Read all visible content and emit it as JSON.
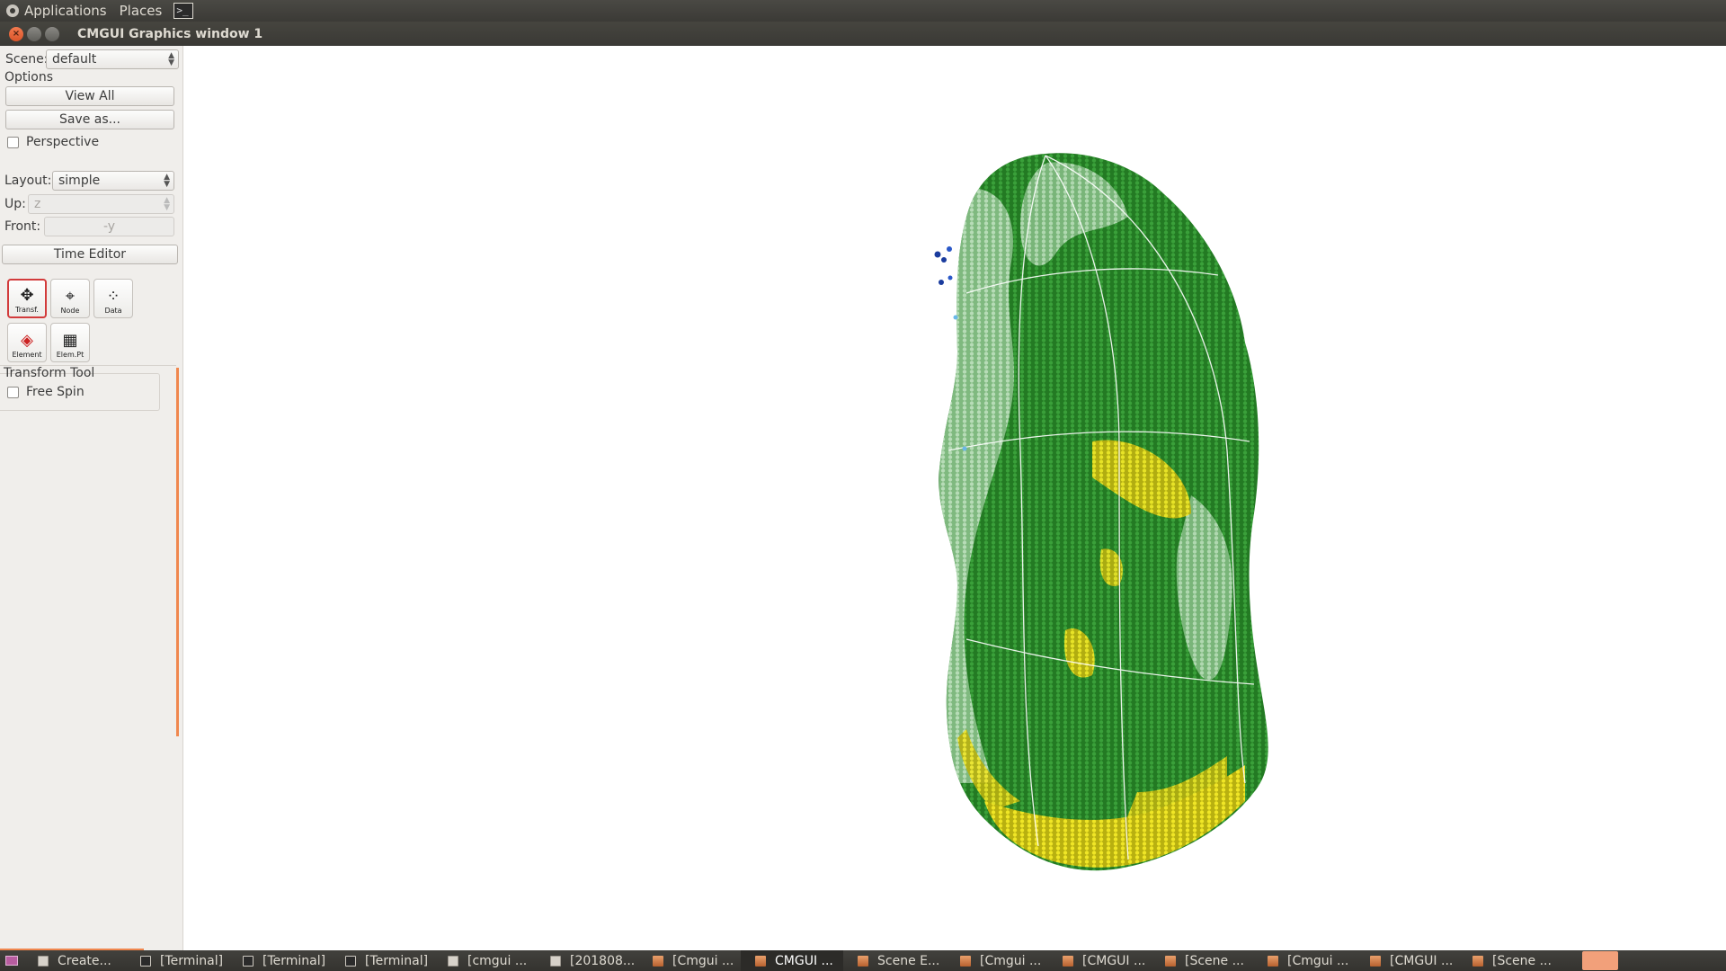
{
  "top_panel": {
    "applications_label": "Applications",
    "places_label": "Places"
  },
  "window": {
    "title": "CMGUI Graphics window 1"
  },
  "left_panel": {
    "scene_label": "Scene:",
    "scene_value": "default",
    "options_label": "Options",
    "view_all_label": "View All",
    "save_as_label": "Save as...",
    "perspective_label": "Perspective",
    "perspective_checked": false,
    "layout_label": "Layout:",
    "layout_value": "simple",
    "up_label": "Up:",
    "up_value": "z",
    "front_label": "Front:",
    "front_value": "-y",
    "time_editor_label": "Time Editor",
    "tools": [
      {
        "label": "Transf.",
        "icon": "transform-icon",
        "active": true
      },
      {
        "label": "Node",
        "icon": "node-tool-icon",
        "active": false
      },
      {
        "label": "Data",
        "icon": "data-tool-icon",
        "active": false
      },
      {
        "label": "Element",
        "icon": "element-tool-icon",
        "active": false
      },
      {
        "label": "Elem.Pt",
        "icon": "element-point-icon",
        "active": false
      }
    ],
    "transform_tool_label": "Transform Tool",
    "free_spin_label": "Free Spin",
    "free_spin_checked": false
  },
  "colors": {
    "point_green": "#2e8b2e",
    "point_light": "#b4dcb4",
    "point_yellow": "#e6e01e",
    "accent_orange": "#f0874e"
  },
  "taskbar": {
    "tasks": [
      {
        "label": "Create...",
        "icon": "doc",
        "active": false
      },
      {
        "label": "[Terminal]",
        "icon": "term",
        "active": false
      },
      {
        "label": "[Terminal]",
        "icon": "term",
        "active": false
      },
      {
        "label": "[Terminal]",
        "icon": "term",
        "active": false
      },
      {
        "label": "[cmgui ...",
        "icon": "doc",
        "active": false
      },
      {
        "label": "[201808...",
        "icon": "doc",
        "active": false
      },
      {
        "label": "[Cmgui ...",
        "icon": "cm",
        "active": false
      },
      {
        "label": "CMGUI ...",
        "icon": "cm",
        "active": true
      },
      {
        "label": "Scene E...",
        "icon": "cm",
        "active": false
      },
      {
        "label": "[Cmgui ...",
        "icon": "cm",
        "active": false
      },
      {
        "label": "[CMGUI ...",
        "icon": "cm",
        "active": false
      },
      {
        "label": "[Scene ...",
        "icon": "cm",
        "active": false
      },
      {
        "label": "[Cmgui ...",
        "icon": "cm",
        "active": false
      },
      {
        "label": "[CMGUI ...",
        "icon": "cm",
        "active": false
      },
      {
        "label": "[Scene ...",
        "icon": "cm",
        "active": false
      }
    ]
  }
}
